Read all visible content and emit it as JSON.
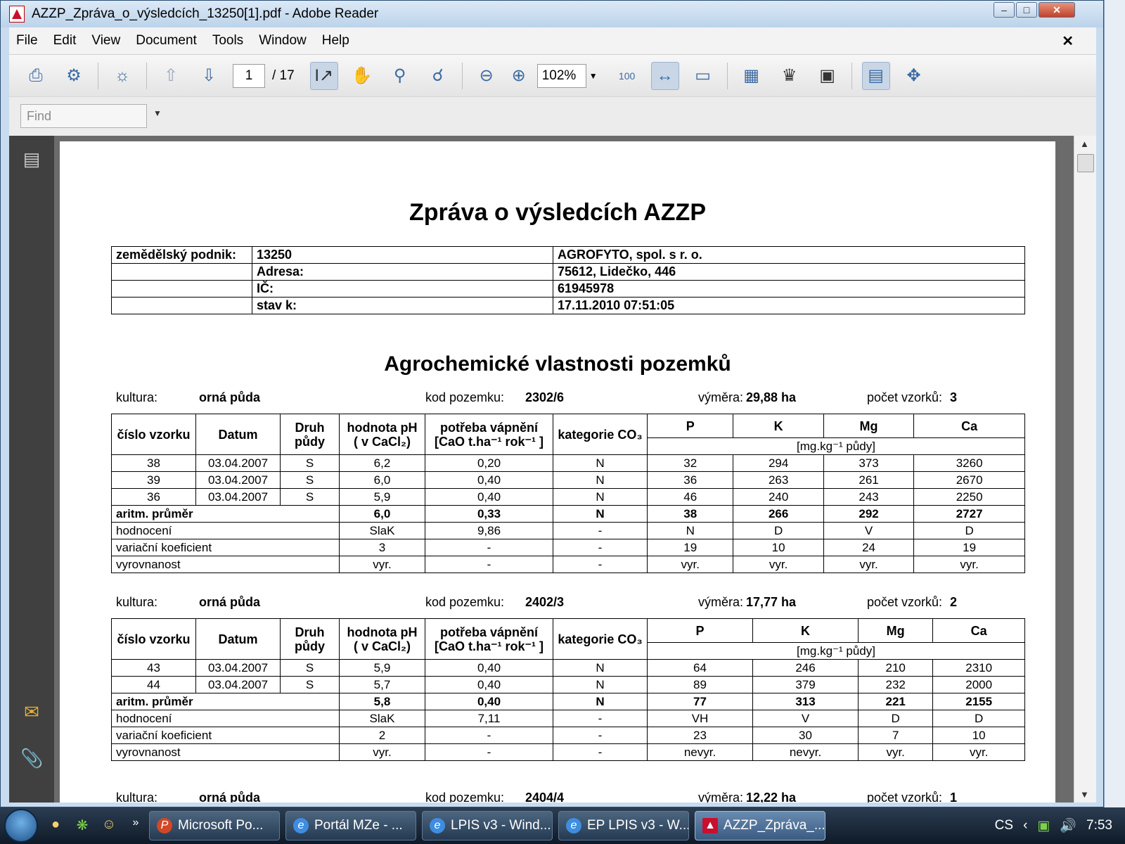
{
  "window": {
    "title": "AZZP_Zpráva_o_výsledcích_13250[1].pdf - Adobe Reader"
  },
  "menu": [
    "File",
    "Edit",
    "View",
    "Document",
    "Tools",
    "Window",
    "Help"
  ],
  "toolbar": {
    "page_current": "1",
    "page_total": "/ 17",
    "zoom": "102%"
  },
  "find": {
    "placeholder": "Find"
  },
  "doc": {
    "title": "Zpráva o výsledcích AZZP",
    "info": {
      "row1": {
        "label": "zemědělský podnik:",
        "code": "13250",
        "name": "AGROFYTO, spol. s r. o."
      },
      "row2": {
        "label": "Adresa:",
        "value": "75612, Lidečko, 446"
      },
      "row3": {
        "label": "IČ:",
        "value": "61945978"
      },
      "row4": {
        "label": "stav k:",
        "value": "17.11.2010 07:51:05"
      }
    },
    "section_title": "Agrochemické vlastnosti pozemků",
    "headers": {
      "cislo": "číslo vzorku",
      "datum": "Datum",
      "druh": "Druh půdy",
      "ph": "hodnota pH ( v CaCl₂)",
      "potreba": "potřeba vápnění [CaO t.ha⁻¹ rok⁻¹ ]",
      "kategorie": "kategorie CO₃",
      "p": "P",
      "k": "K",
      "mg": "Mg",
      "ca": "Ca",
      "unit": "[mg.kg⁻¹ půdy]"
    },
    "blocks": [
      {
        "kultura_label": "kultura:",
        "kultura": "orná půda",
        "kod_label": "kod pozemku:",
        "kod": "2302/6",
        "vymera_label": "výměra:",
        "vymera": "29,88 ha",
        "pocet_label": "počet vzorků:",
        "pocet": "3",
        "rows": [
          [
            "38",
            "03.04.2007",
            "S",
            "6,2",
            "0,20",
            "N",
            "32",
            "294",
            "373",
            "3260"
          ],
          [
            "39",
            "03.04.2007",
            "S",
            "6,0",
            "0,40",
            "N",
            "36",
            "263",
            "261",
            "2670"
          ],
          [
            "36",
            "03.04.2007",
            "S",
            "5,9",
            "0,40",
            "N",
            "46",
            "240",
            "243",
            "2250"
          ]
        ],
        "summary": [
          [
            "aritm. průměr",
            "6,0",
            "0,33",
            "N",
            "38",
            "266",
            "292",
            "2727"
          ],
          [
            "hodnocení",
            "SlaK",
            "9,86",
            "-",
            "N",
            "D",
            "V",
            "D"
          ],
          [
            "variační koeficient",
            "3",
            "-",
            "-",
            "19",
            "10",
            "24",
            "19"
          ],
          [
            "vyrovnanost",
            "vyr.",
            "-",
            "-",
            "vyr.",
            "vyr.",
            "vyr.",
            "vyr."
          ]
        ]
      },
      {
        "kultura_label": "kultura:",
        "kultura": "orná půda",
        "kod_label": "kod pozemku:",
        "kod": "2402/3",
        "vymera_label": "výměra:",
        "vymera": "17,77 ha",
        "pocet_label": "počet vzorků:",
        "pocet": "2",
        "rows": [
          [
            "43",
            "03.04.2007",
            "S",
            "5,9",
            "0,40",
            "N",
            "64",
            "246",
            "210",
            "2310"
          ],
          [
            "44",
            "03.04.2007",
            "S",
            "5,7",
            "0,40",
            "N",
            "89",
            "379",
            "232",
            "2000"
          ]
        ],
        "summary": [
          [
            "aritm. průměr",
            "5,8",
            "0,40",
            "N",
            "77",
            "313",
            "221",
            "2155"
          ],
          [
            "hodnocení",
            "SlaK",
            "7,11",
            "-",
            "VH",
            "V",
            "D",
            "D"
          ],
          [
            "variační koeficient",
            "2",
            "-",
            "-",
            "23",
            "30",
            "7",
            "10"
          ],
          [
            "vyrovnanost",
            "vyr.",
            "-",
            "-",
            "nevyr.",
            "nevyr.",
            "vyr.",
            "vyr."
          ]
        ]
      },
      {
        "kultura_label": "kultura:",
        "kultura": "orná půda",
        "kod_label": "kod pozemku:",
        "kod": "2404/4",
        "vymera_label": "výměra:",
        "vymera": "12,22 ha",
        "pocet_label": "počet vzorků:",
        "pocet": "1"
      }
    ]
  },
  "taskbar": {
    "tasks": [
      "Microsoft Po...",
      "Portál MZe - ...",
      "LPIS v3 - Wind...",
      "EP LPIS v3 - W...",
      "AZZP_Zpráva_..."
    ],
    "lang": "CS",
    "clock": "7:53"
  }
}
